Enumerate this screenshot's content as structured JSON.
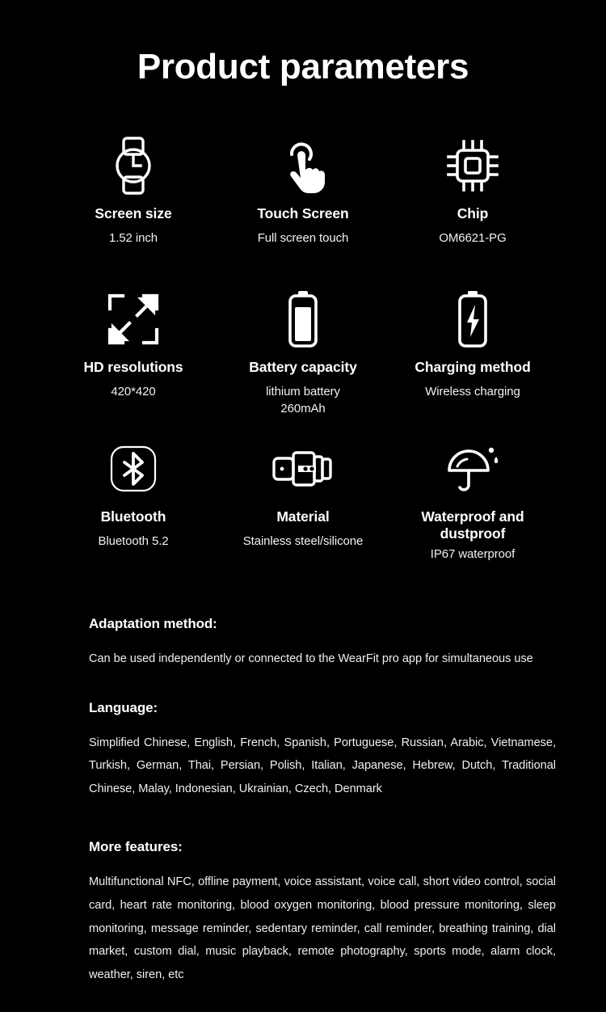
{
  "page": {
    "title": "Product parameters",
    "background_color": "#000000",
    "text_color": "#ffffff"
  },
  "specs": [
    {
      "icon": "watch-icon",
      "label": "Screen size",
      "value": "1.52 inch"
    },
    {
      "icon": "touch-hand-icon",
      "label": "Touch Screen",
      "value": "Full screen touch"
    },
    {
      "icon": "chip-icon",
      "label": "Chip",
      "value": "OM6621-PG"
    },
    {
      "icon": "expand-resolution-icon",
      "label": "HD resolutions",
      "value": "420*420"
    },
    {
      "icon": "battery-icon",
      "label": "Battery capacity",
      "value": "lithium battery\n260mAh",
      "value_line1": "lithium battery",
      "value_line2": "260mAh"
    },
    {
      "icon": "battery-charging-icon",
      "label": "Charging method",
      "value": "Wireless charging"
    },
    {
      "icon": "bluetooth-icon",
      "label": "Bluetooth",
      "value": "Bluetooth 5.2"
    },
    {
      "icon": "watch-strap-icon",
      "label": "Material",
      "value": "Stainless steel/silicone"
    },
    {
      "icon": "umbrella-waterproof-icon",
      "label": "Waterproof and dustproof",
      "value": "IP67 waterproof"
    }
  ],
  "sections": [
    {
      "heading": "Adaptation method:",
      "body": "Can be used independently or connected to the WearFit pro app for simultaneous use"
    },
    {
      "heading": "Language:",
      "body": "Simplified Chinese, English, French, Spanish, Portuguese, Russian, Arabic, Vietnamese, Turkish, German, Thai, Persian, Polish, Italian, Japanese, Hebrew, Dutch, Traditional Chinese, Malay, Indonesian, Ukrainian, Czech, Denmark"
    },
    {
      "heading": "More features:",
      "body": "Multifunctional NFC, offline payment, voice assistant, voice call, short video control, social card, heart rate monitoring, blood oxygen monitoring, blood pressure monitoring, sleep monitoring, message reminder, sedentary reminder, call reminder, breathing training, dial market, custom dial, music playback, remote photography, sports mode, alarm clock, weather, siren, etc"
    }
  ]
}
